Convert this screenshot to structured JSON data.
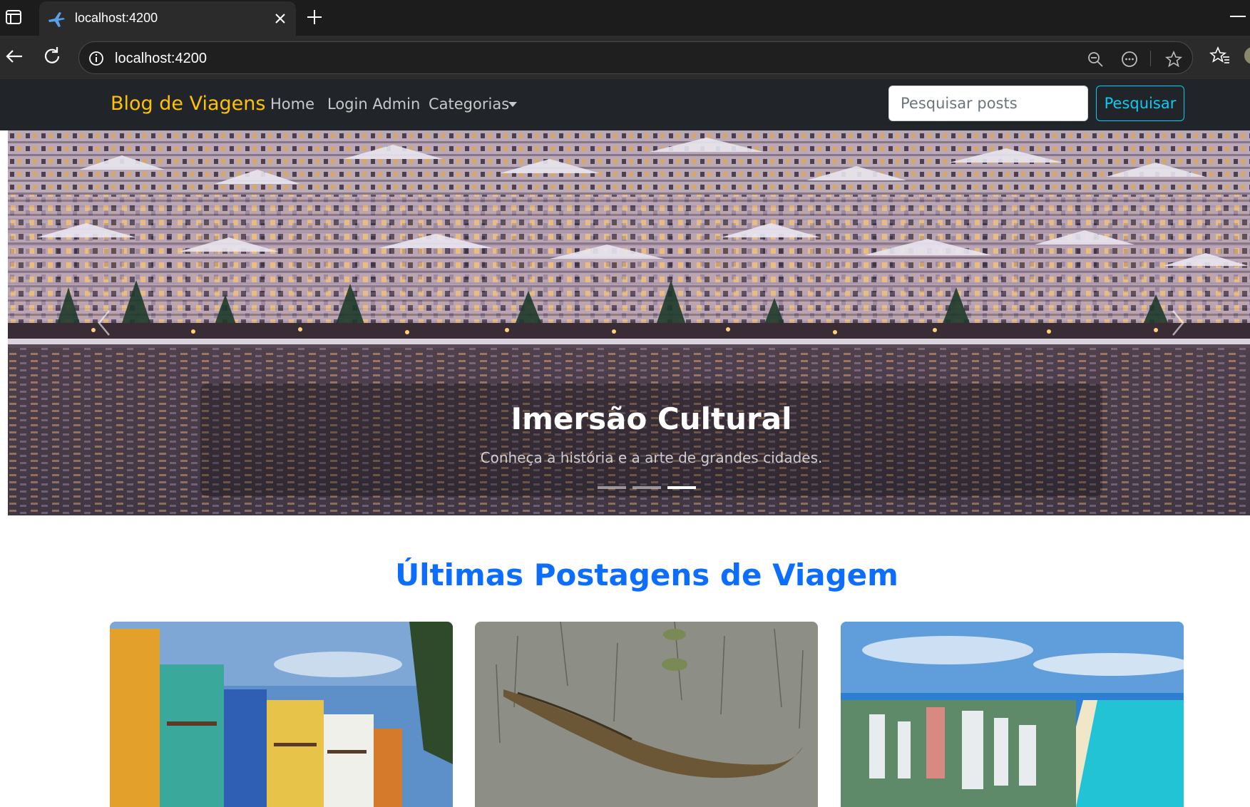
{
  "browser": {
    "tab_title": "localhost:4200",
    "url": "localhost:4200"
  },
  "navbar": {
    "brand": "Blog de Viagens",
    "links": [
      "Home",
      "Login Admin",
      "Categorias"
    ],
    "search_placeholder": "Pesquisar posts",
    "search_button": "Pesquisar"
  },
  "carousel": {
    "caption_title": "Imersão Cultural",
    "caption_text": "Conheça a história e a arte de grandes cidades.",
    "slide_count": 3,
    "active_slide": 3
  },
  "main": {
    "section_title": "Últimas Postagens de Viagem"
  },
  "colors": {
    "navbar_bg": "#212529",
    "brand": "#ffc107",
    "accent": "#0d6efd",
    "search_outline": "#0dcaf0"
  }
}
